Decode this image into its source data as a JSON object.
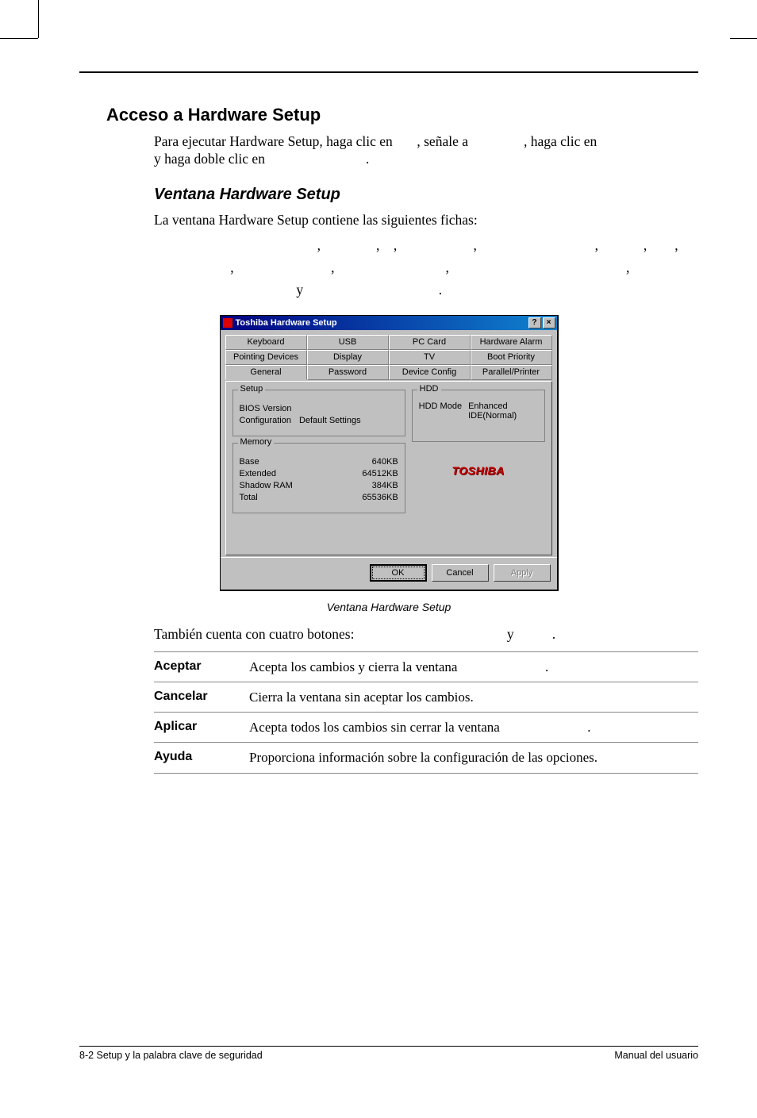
{
  "section_title": "Acceso a Hardware Setup",
  "intro_text": "Para ejecutar Hardware Setup, haga clic en       , señale a                , haga clic en                            y haga doble clic en                             .",
  "subsection_title": "Ventana Hardware Setup",
  "subsection_intro": "La ventana Hardware Setup contiene las siguientes fichas:",
  "tabs_list_text": "                                               ,                ,    ,                      ,                                  ,             ,        ,                       ,                            ,                                ,                                                   ,                                          y                                       .",
  "dialog": {
    "title": "Toshiba Hardware Setup",
    "help_btn": "?",
    "close_btn": "×",
    "tabs_row1": [
      "Keyboard",
      "USB",
      "PC Card",
      "Hardware Alarm"
    ],
    "tabs_row2": [
      "Pointing Devices",
      "Display",
      "TV",
      "Boot Priority"
    ],
    "tabs_row3": [
      "General",
      "Password",
      "Device Config",
      "Parallel/Printer"
    ],
    "setup_legend": "Setup",
    "bios_label": "BIOS Version",
    "config_label": "Configuration",
    "config_value": "Default Settings",
    "hdd_legend": "HDD",
    "hdd_mode_label": "HDD Mode",
    "hdd_mode_value": "Enhanced IDE(Normal)",
    "memory_legend": "Memory",
    "mem": [
      {
        "k": "Base",
        "v": "640KB"
      },
      {
        "k": "Extended",
        "v": "64512KB"
      },
      {
        "k": "Shadow RAM",
        "v": "384KB"
      },
      {
        "k": "Total",
        "v": "65536KB"
      }
    ],
    "logo": "TOSHIBA",
    "ok": "OK",
    "cancel": "Cancel",
    "apply": "Apply"
  },
  "caption": "Ventana Hardware Setup",
  "after_caption": "También cuenta con cuatro botones:                                            y           .",
  "defs": [
    {
      "term": "Aceptar",
      "desc": "Acepta los cambios y cierra la ventana                          ."
    },
    {
      "term": "Cancelar",
      "desc": "Cierra la ventana sin aceptar los cambios."
    },
    {
      "term": "Aplicar",
      "desc": "Acepta todos los cambios sin cerrar la ventana                          ."
    },
    {
      "term": "Ayuda",
      "desc": "Proporciona información sobre la configuración de las opciones."
    }
  ],
  "footer_left": "8-2  Setup y la palabra clave de seguridad",
  "footer_right": "Manual del usuario"
}
